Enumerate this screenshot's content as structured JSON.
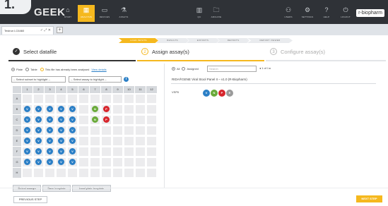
{
  "app": {
    "logo_text": "1.",
    "brand": "GEEK",
    "vendor_logo": "r-biopharm"
  },
  "nav_left": [
    {
      "label": "START",
      "icon": "home-icon",
      "glyph": "⌂",
      "active": false
    },
    {
      "label": "ANALYSIS",
      "icon": "grid-icon",
      "glyph": "▦",
      "active": true
    },
    {
      "label": "DEVICES",
      "icon": "monitor-icon",
      "glyph": "▭",
      "active": false
    },
    {
      "label": "ASSAYS",
      "icon": "flask-icon",
      "glyph": "⚗",
      "active": false
    }
  ],
  "nav_mid": [
    {
      "label": "QC",
      "icon": "qc-icon",
      "glyph": "▥"
    },
    {
      "label": "ARCHIVE",
      "icon": "archive-icon",
      "glyph": "🗀"
    }
  ],
  "nav_right": [
    {
      "label": "USERS",
      "icon": "users-icon",
      "glyph": "⚇"
    },
    {
      "label": "SETTINGS",
      "icon": "gear-icon",
      "glyph": "⚙"
    },
    {
      "label": "HELP",
      "icon": "help-icon",
      "glyph": "?"
    },
    {
      "label": "LOGOUT",
      "icon": "logout-icon",
      "glyph": "⏻"
    }
  ],
  "tab": {
    "label": "Testrun LC6460",
    "actions": "✓ ⤢ ✕",
    "add": "+"
  },
  "chevrons": [
    {
      "label": "LOAD INPUTS",
      "active": true
    },
    {
      "label": "RESULTS",
      "active": false
    },
    {
      "label": "EXPORTS",
      "active": false
    },
    {
      "label": "REPORTS",
      "active": false
    },
    {
      "label": "REPORT VIEWER",
      "active": false
    }
  ],
  "steps": [
    {
      "label": "Select datafile",
      "state": "done",
      "glyph": "✓",
      "color": "#333333"
    },
    {
      "label": "Assign assay(s)",
      "state": "current",
      "glyph": "2",
      "color": "#f5b81e"
    },
    {
      "label": "Configure assay(s)",
      "state": "todo",
      "glyph": "3",
      "color": "#ffffff"
    }
  ],
  "left": {
    "view_plate": "Plate",
    "view_table": "Table",
    "notice": "This file has already been analysed",
    "view_details": "View details",
    "subset_select": "-- Select subset to highlight --",
    "assay_select": "-- Select assay to highlight --",
    "info": "i",
    "columns": [
      "1",
      "2",
      "3",
      "4",
      "5",
      "6",
      "7",
      "8",
      "9",
      "10",
      "11",
      "12"
    ],
    "rows": [
      "A",
      "B",
      "C",
      "D",
      "E",
      "F",
      "G",
      "H"
    ],
    "wells": [
      {
        "row": 1,
        "col": 0,
        "letter": "V",
        "color": "#2b7fc6"
      },
      {
        "row": 1,
        "col": 1,
        "letter": "V",
        "color": "#2b7fc6"
      },
      {
        "row": 1,
        "col": 2,
        "letter": "V",
        "color": "#2b7fc6"
      },
      {
        "row": 1,
        "col": 3,
        "letter": "V",
        "color": "#2b7fc6"
      },
      {
        "row": 1,
        "col": 4,
        "letter": "V",
        "color": "#2b7fc6"
      },
      {
        "row": 1,
        "col": 6,
        "letter": "N",
        "color": "#6aaa3a"
      },
      {
        "row": 1,
        "col": 7,
        "letter": "P",
        "color": "#d7262d"
      },
      {
        "row": 2,
        "col": 0,
        "letter": "V",
        "color": "#2b7fc6"
      },
      {
        "row": 2,
        "col": 1,
        "letter": "V",
        "color": "#2b7fc6"
      },
      {
        "row": 2,
        "col": 2,
        "letter": "V",
        "color": "#2b7fc6"
      },
      {
        "row": 2,
        "col": 3,
        "letter": "V",
        "color": "#2b7fc6"
      },
      {
        "row": 2,
        "col": 4,
        "letter": "V",
        "color": "#2b7fc6"
      },
      {
        "row": 2,
        "col": 6,
        "letter": "N",
        "color": "#6aaa3a"
      },
      {
        "row": 2,
        "col": 7,
        "letter": "P",
        "color": "#d7262d"
      },
      {
        "row": 3,
        "col": 0,
        "letter": "V",
        "color": "#2b7fc6"
      },
      {
        "row": 3,
        "col": 1,
        "letter": "V",
        "color": "#2b7fc6"
      },
      {
        "row": 3,
        "col": 2,
        "letter": "V",
        "color": "#2b7fc6"
      },
      {
        "row": 3,
        "col": 3,
        "letter": "V",
        "color": "#2b7fc6"
      },
      {
        "row": 3,
        "col": 4,
        "letter": "V",
        "color": "#2b7fc6"
      },
      {
        "row": 4,
        "col": 0,
        "letter": "V",
        "color": "#2b7fc6"
      },
      {
        "row": 4,
        "col": 1,
        "letter": "V",
        "color": "#2b7fc6"
      },
      {
        "row": 4,
        "col": 2,
        "letter": "V",
        "color": "#2b7fc6"
      },
      {
        "row": 4,
        "col": 3,
        "letter": "V",
        "color": "#2b7fc6"
      },
      {
        "row": 4,
        "col": 4,
        "letter": "V",
        "color": "#2b7fc6"
      },
      {
        "row": 5,
        "col": 0,
        "letter": "V",
        "color": "#2b7fc6"
      },
      {
        "row": 5,
        "col": 1,
        "letter": "V",
        "color": "#2b7fc6"
      },
      {
        "row": 5,
        "col": 2,
        "letter": "V",
        "color": "#2b7fc6"
      },
      {
        "row": 5,
        "col": 3,
        "letter": "V",
        "color": "#2b7fc6"
      },
      {
        "row": 5,
        "col": 4,
        "letter": "V",
        "color": "#2b7fc6"
      },
      {
        "row": 6,
        "col": 0,
        "letter": "V",
        "color": "#2b7fc6"
      },
      {
        "row": 6,
        "col": 1,
        "letter": "V",
        "color": "#2b7fc6"
      },
      {
        "row": 6,
        "col": 2,
        "letter": "V",
        "color": "#2b7fc6"
      },
      {
        "row": 6,
        "col": 3,
        "letter": "V",
        "color": "#2b7fc6"
      },
      {
        "row": 6,
        "col": 4,
        "letter": "V",
        "color": "#2b7fc6"
      }
    ],
    "btn_detect": "Detect assays",
    "btn_save": "Save template",
    "btn_load": "Load plate template"
  },
  "right": {
    "filter_all": "All",
    "filter_assigned": "Assigned",
    "search_placeholder": "Search",
    "pager": "◂ 1 of 1 ▸",
    "assay_name": "RIDA®GENE Viral Stool Panel II – v1.0 (R-Biopharm)",
    "assay_code": "VSPII",
    "chips": [
      {
        "letter": "V",
        "color": "#2b7fc6"
      },
      {
        "letter": "N",
        "color": "#6aaa3a"
      },
      {
        "letter": "P",
        "color": "#d7262d"
      },
      {
        "letter": "E",
        "color": "#9a9a9a"
      }
    ]
  },
  "footer": {
    "prev": "PREVIOUS STEP",
    "next": "NEXT STEP"
  },
  "colors": {
    "accent": "#f5b81e",
    "topbar": "#2f3237",
    "blue": "#2b7fc6",
    "green": "#6aaa3a",
    "red": "#d7262d"
  }
}
